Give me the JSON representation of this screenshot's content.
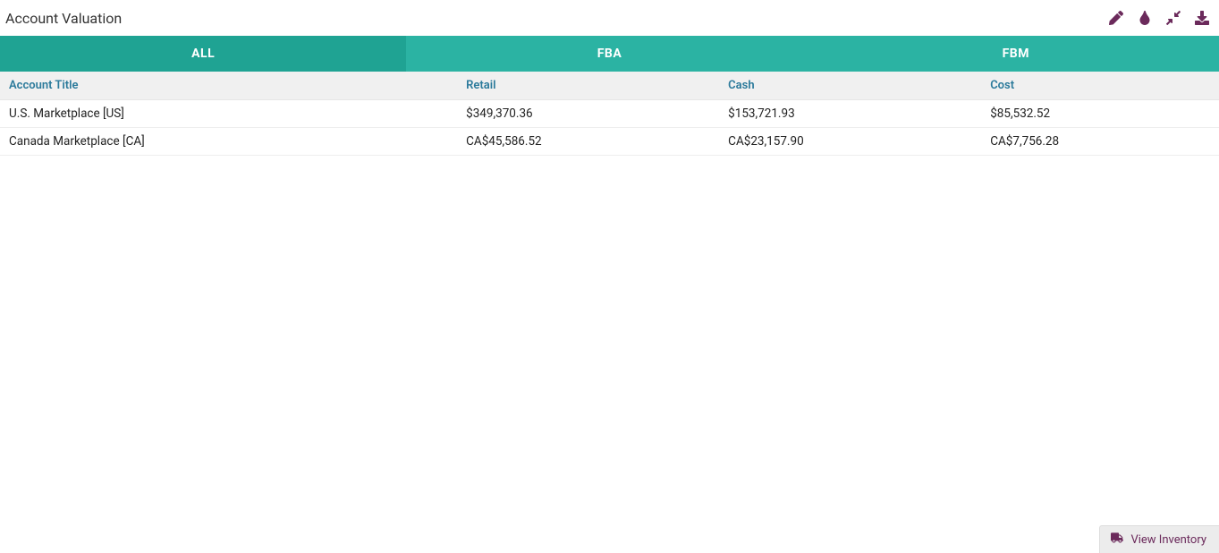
{
  "header": {
    "title": "Account Valuation"
  },
  "tabs": [
    {
      "label": "ALL",
      "active": true
    },
    {
      "label": "FBA",
      "active": false
    },
    {
      "label": "FBM",
      "active": false
    }
  ],
  "columns": {
    "account_title": "Account Title",
    "retail": "Retail",
    "cash": "Cash",
    "cost": "Cost"
  },
  "rows": [
    {
      "title": "U.S. Marketplace [US]",
      "retail": "$349,370.36",
      "cash": "$153,721.93",
      "cost": "$85,532.52"
    },
    {
      "title": "Canada Marketplace [CA]",
      "retail": "CA$45,586.52",
      "cash": "CA$23,157.90",
      "cost": "CA$7,756.28"
    }
  ],
  "footer": {
    "view_inventory": "View Inventory"
  }
}
